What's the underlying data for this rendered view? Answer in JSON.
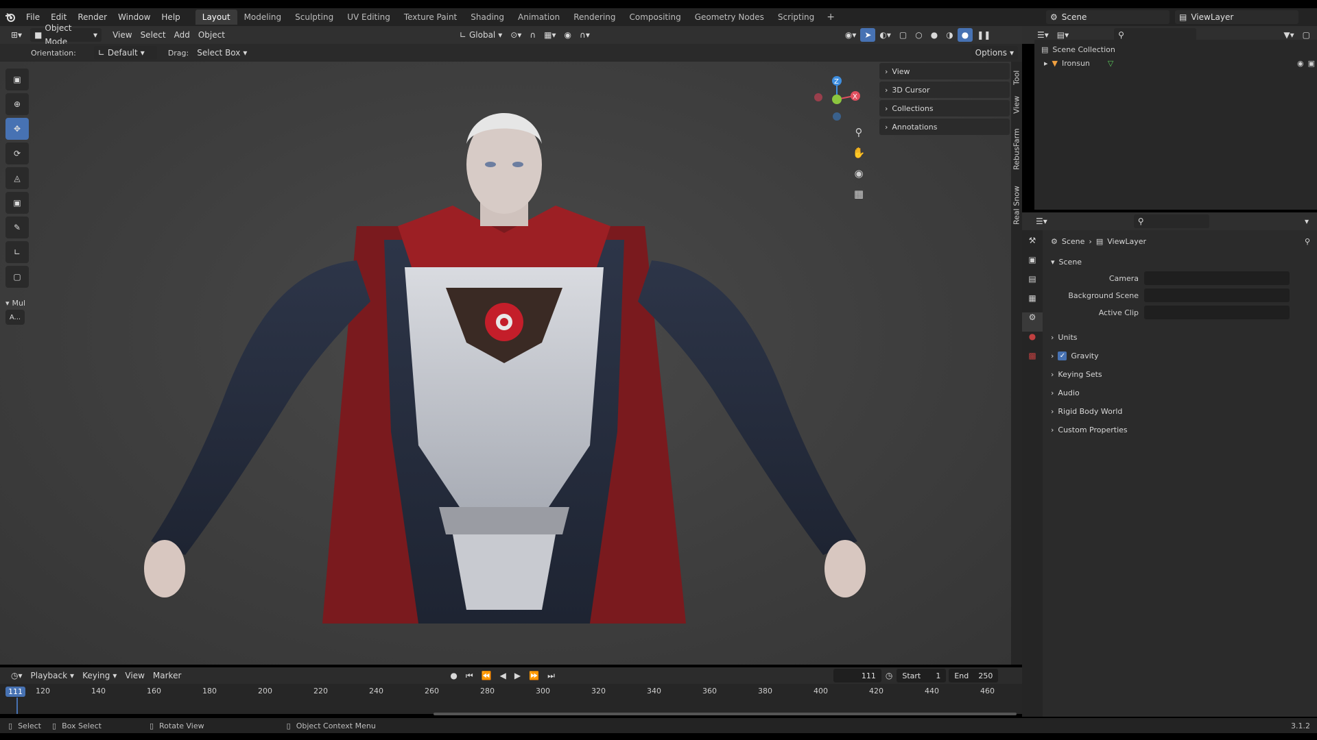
{
  "menu": [
    "File",
    "Edit",
    "Render",
    "Window",
    "Help"
  ],
  "workspaces": [
    "Layout",
    "Modeling",
    "Sculpting",
    "UV Editing",
    "Texture Paint",
    "Shading",
    "Animation",
    "Rendering",
    "Compositing",
    "Geometry Nodes",
    "Scripting"
  ],
  "active_workspace": "Layout",
  "scene_name": "Scene",
  "view_layer": "ViewLayer",
  "viewport_header": {
    "mode": "Object Mode",
    "menus": [
      "View",
      "Select",
      "Add",
      "Object"
    ],
    "transform_orientation": "Global"
  },
  "tool_settings": {
    "orientation_label": "Orientation:",
    "orientation_value": "Default",
    "drag_label": "Drag:",
    "drag_value": "Select Box",
    "options": "Options"
  },
  "npanel": {
    "items": [
      "View",
      "3D Cursor",
      "Collections",
      "Annotations"
    ],
    "tabs": [
      "Tool",
      "View",
      "RebusFarm",
      "Real Snow"
    ]
  },
  "toolbar_extra": {
    "label": "Mul",
    "button": "A..."
  },
  "outliner": {
    "root": "Scene Collection",
    "object": "Ironsun"
  },
  "properties": {
    "breadcrumb_scene": "Scene",
    "breadcrumb_layer": "ViewLayer",
    "section": "Scene",
    "camera_label": "Camera",
    "background_scene_label": "Background Scene",
    "active_clip_label": "Active Clip",
    "panels": [
      "Units",
      "Gravity",
      "Keying Sets",
      "Audio",
      "Rigid Body World",
      "Custom Properties"
    ],
    "gravity_checked": true
  },
  "timeline": {
    "menus": [
      "Playback",
      "Keying",
      "View",
      "Marker"
    ],
    "current_frame": "111",
    "start_label": "Start",
    "start": "1",
    "end_label": "End",
    "end": "250",
    "ticks": [
      "120",
      "140",
      "160",
      "180",
      "200",
      "220",
      "240",
      "260",
      "280",
      "300",
      "320",
      "340",
      "360",
      "380",
      "400",
      "420",
      "440",
      "460"
    ]
  },
  "statusbar": {
    "select": "Select",
    "box_select": "Box Select",
    "rotate_view": "Rotate View",
    "context_menu": "Object Context Menu",
    "version": "3.1.2"
  },
  "colors": {
    "accent": "#4772b3",
    "axis_x": "#e04f5f",
    "axis_y": "#8cc63f",
    "axis_z": "#3e8ee0"
  }
}
